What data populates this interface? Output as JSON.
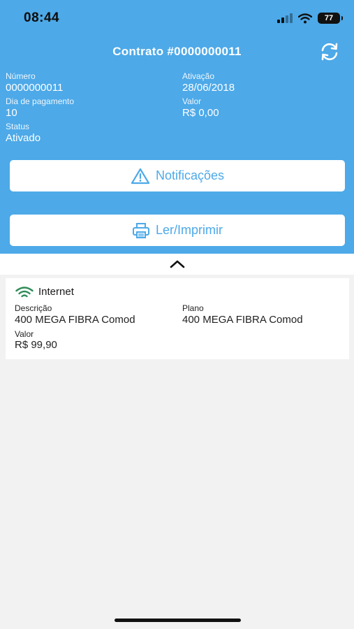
{
  "status_bar": {
    "time": "08:44",
    "battery": "77"
  },
  "header": {
    "title": "Contrato #0000000011",
    "refresh_icon": "refresh-icon",
    "fields": {
      "numero": {
        "label": "Número",
        "value": "0000000011"
      },
      "ativacao": {
        "label": "Ativação",
        "value": "28/06/2018"
      },
      "dia_pagamento": {
        "label": "Dia de pagamento",
        "value": "10"
      },
      "valor": {
        "label": "Valor",
        "value": "R$ 0,00"
      },
      "status": {
        "label": "Status",
        "value": "Ativado"
      }
    }
  },
  "buttons": {
    "notificacoes": {
      "label": "Notificações",
      "icon": "warning-icon"
    },
    "ler_imprimir": {
      "label": "Ler/Imprimir",
      "icon": "printer-icon"
    }
  },
  "collapse": {
    "icon": "chevron-up-icon"
  },
  "service_card": {
    "icon": "wifi-icon",
    "icon_color": "#2e8b57",
    "title": "Internet",
    "descricao": {
      "label": "Descrição",
      "value": "400 MEGA FIBRA Comod"
    },
    "plano": {
      "label": "Plano",
      "value": "400 MEGA FIBRA Comod"
    },
    "valor": {
      "label": "Valor",
      "value": "R$ 99,90"
    }
  },
  "colors": {
    "primary": "#4da9e8",
    "background": "#f2f2f2"
  }
}
